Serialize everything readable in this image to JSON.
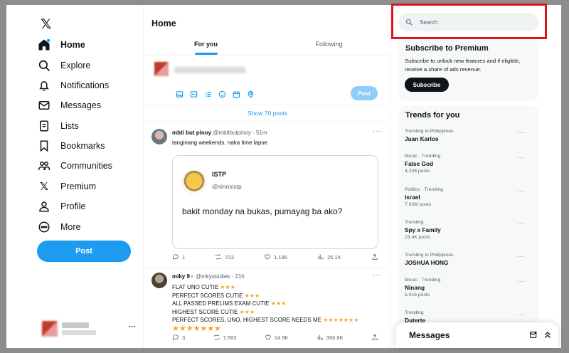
{
  "nav": {
    "items": [
      {
        "label": "Home",
        "icon": "home-icon"
      },
      {
        "label": "Explore",
        "icon": "search-icon"
      },
      {
        "label": "Notifications",
        "icon": "bell-icon"
      },
      {
        "label": "Messages",
        "icon": "envelope-icon"
      },
      {
        "label": "Lists",
        "icon": "list-icon"
      },
      {
        "label": "Bookmarks",
        "icon": "bookmark-icon"
      },
      {
        "label": "Communities",
        "icon": "people-icon"
      },
      {
        "label": "Premium",
        "icon": "x-logo-icon"
      },
      {
        "label": "Profile",
        "icon": "person-icon"
      },
      {
        "label": "More",
        "icon": "more-circle-icon"
      }
    ],
    "post_label": "Post",
    "account_more": "···"
  },
  "main": {
    "title": "Home",
    "tabs": [
      {
        "label": "For you"
      },
      {
        "label": "Following"
      }
    ],
    "compose": {
      "post_label": "Post"
    },
    "show_posts": "Show 70 posts"
  },
  "tweets": [
    {
      "name": "mbti but pinoy",
      "handle": "@mbtibutpinoy",
      "time": "· 51m",
      "text": "tanginang weekends, naka time lapse",
      "quote": {
        "name": "ISTP",
        "handle": "@sinosistp",
        "text": "bakit monday na bukas, pumayag ba ako?"
      },
      "replies": "1",
      "reposts": "723",
      "likes": "1,186",
      "views": "25.1K"
    },
    {
      "name": "miky 9",
      "name_symbol": "♀",
      "handle": "@mkystudies",
      "time": "· 21h",
      "lines": [
        "FLAT UNO CUTIE ★★★",
        "PERFECT SCORES CUTIE ★★★",
        "ALL PASSED PRELIMS EXAM CUTIE ★★★",
        "HIGHEST SCORE CUTIE ★★★",
        "PERFECT SCORES, UNO, HIGHEST SCORE NEEDS ME ★★★★★★★",
        "★★★★★★★"
      ],
      "replies": "3",
      "reposts": "7,563",
      "likes": "14.9K",
      "views": "366.8K"
    }
  ],
  "right": {
    "search_placeholder": "Search",
    "premium": {
      "title": "Subscribe to Premium",
      "desc": "Subscribe to unlock new features and if eligible, receive a share of ads revenue.",
      "button": "Subscribe"
    },
    "trends_title": "Trends for you",
    "trends": [
      {
        "category": "Trending in Philippines",
        "name": "Juan Karlos",
        "count": ""
      },
      {
        "category": "Music · Trending",
        "name": "False God",
        "count": "4,338 posts"
      },
      {
        "category": "Politics · Trending",
        "name": "Israel",
        "count": "7.92M posts"
      },
      {
        "category": "Trending",
        "name": "Spy x Family",
        "count": "23.4K posts"
      },
      {
        "category": "Trending in Philippines",
        "name": "JOSHUA HONG",
        "count": ""
      },
      {
        "category": "Music · Trending",
        "name": "Ninang",
        "count": "5,016 posts"
      },
      {
        "category": "Trending",
        "name": "Duterte",
        "count": ""
      }
    ]
  },
  "messages_drawer": {
    "title": "Messages"
  },
  "colors": {
    "accent": "#1d9bf0",
    "star": "#f4a623",
    "highlight": "#e0131c"
  }
}
